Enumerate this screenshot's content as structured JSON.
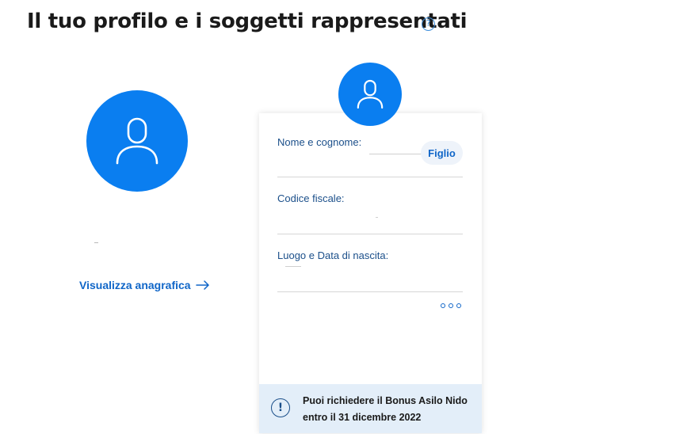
{
  "header": {
    "title": "Il tuo profilo e i soggetti rappresentati",
    "help_icon": "question-circle-icon",
    "help_glyph": "?"
  },
  "profile": {
    "avatar_icon": "user-icon",
    "link_label": "Visualizza anagrafica",
    "link_icon": "arrow-right-icon"
  },
  "represented_card": {
    "avatar_icon": "user-icon",
    "badge": "Figlio",
    "fields": [
      {
        "label": "Nome e cognome:"
      },
      {
        "label": "Codice fiscale:"
      },
      {
        "label": "Luogo e Data di nascita:"
      }
    ],
    "more_icon": "more-dots-icon"
  },
  "notice": {
    "icon": "exclamation-circle-icon",
    "glyph": "!",
    "line1": "Puoi richiedere il Bonus Asilo Nido",
    "line2": "entro il 31 dicembre 2022"
  },
  "colors": {
    "accent": "#0a7ef0",
    "link": "#1066c8",
    "notice_bg": "#e3eef9"
  }
}
